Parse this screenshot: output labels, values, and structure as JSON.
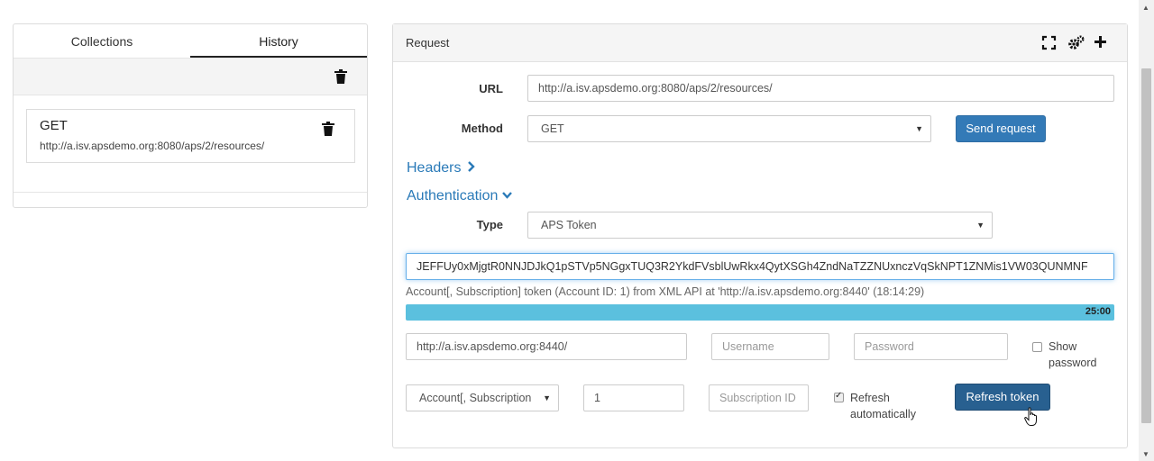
{
  "left": {
    "tabs": [
      {
        "label": "Collections"
      },
      {
        "label": "History"
      }
    ],
    "history": [
      {
        "method": "GET",
        "url": "http://a.isv.apsdemo.org:8080/aps/2/resources/"
      }
    ]
  },
  "request": {
    "title": "Request",
    "url_label": "URL",
    "url_value": "http://a.isv.apsdemo.org:8080/aps/2/resources/",
    "method_label": "Method",
    "method_value": "GET",
    "send_label": "Send request",
    "headers_link": "Headers",
    "auth_link": "Authentication",
    "type_label": "Type",
    "type_value": "APS Token",
    "token_value": "JEFFUy0xMjgtR0NNJDJkQ1pSTVp5NGgxTUQ3R2YkdFVsblUwRkx4QytXSGh4ZndNaTZZNUxnczVqSkNPT1ZNMis1VW03QUNMNF",
    "token_info": "Account[, Subscription] token (Account ID: 1) from XML API at 'http://a.isv.apsdemo.org:8440' (18:14:29)",
    "progress_text": "25:00",
    "progress_fraction": 1.0,
    "endpoint_value": "http://a.isv.apsdemo.org:8440/",
    "username_placeholder": "Username",
    "password_placeholder": "Password",
    "show_password_label": "Show password",
    "scope_value": "Account[, Subscription",
    "account_id_value": "1",
    "subscription_placeholder": "Subscription ID",
    "refresh_auto_label": "Refresh automatically",
    "refresh_auto_checked": true,
    "show_password_checked": false,
    "refresh_token_label": "Refresh token"
  },
  "colors": {
    "primary": "#337ab7",
    "primary_dark": "#286090",
    "link": "#2a7ab8",
    "progress": "#5bc0de"
  },
  "icons": [
    "trash-icon",
    "fullscreen-icon",
    "settings-gears-icon",
    "plus-icon",
    "chevron-right-icon",
    "chevron-down-icon",
    "caret-down-icon",
    "hand-cursor-icon"
  ]
}
